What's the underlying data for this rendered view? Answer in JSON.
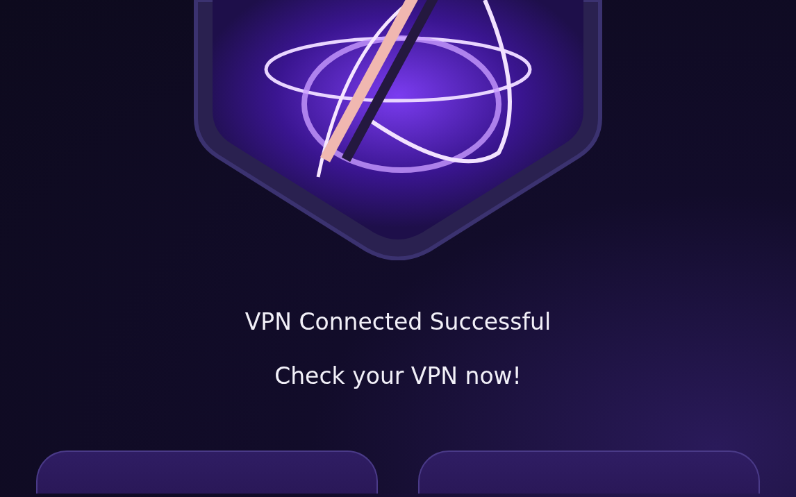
{
  "message": {
    "title": "VPN Connected Successful",
    "subtitle": "Check your VPN now!"
  }
}
